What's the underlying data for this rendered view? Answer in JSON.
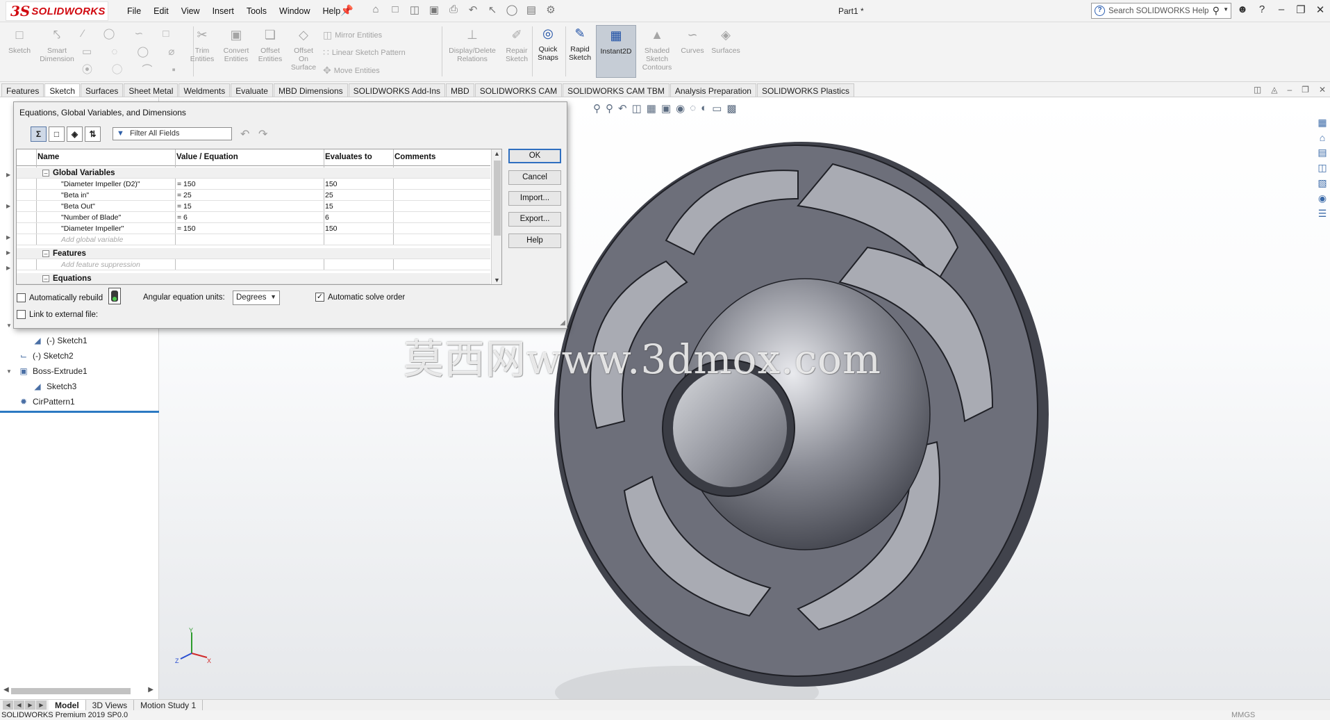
{
  "app": {
    "logo_ds": "3S",
    "logo_text": "SOLIDWORKS",
    "document_title": "Part1 *",
    "search_placeholder": "Search SOLIDWORKS Help"
  },
  "menu": [
    "File",
    "Edit",
    "View",
    "Insert",
    "Tools",
    "Window",
    "Help"
  ],
  "command_manager": {
    "sketch": "Sketch",
    "smart_dimension": [
      "Smart",
      "Dimension"
    ],
    "trim": [
      "Trim",
      "Entities"
    ],
    "convert": [
      "Convert",
      "Entities"
    ],
    "offset": [
      "Offset",
      "Entities"
    ],
    "offset_surface": [
      "Offset",
      "On",
      "Surface"
    ],
    "mirror": "Mirror Entities",
    "linear_pattern": "Linear Sketch Pattern",
    "move": "Move Entities",
    "display_delete": [
      "Display/Delete",
      "Relations"
    ],
    "repair": [
      "Repair",
      "Sketch"
    ],
    "quick_snaps": [
      "Quick",
      "Snaps"
    ],
    "rapid_sketch": [
      "Rapid",
      "Sketch"
    ],
    "instant2d": "Instant2D",
    "shaded_sketch": [
      "Shaded",
      "Sketch",
      "Contours"
    ],
    "curves": "Curves",
    "surfaces": "Surfaces"
  },
  "tabs": [
    {
      "label": "Features",
      "active": false
    },
    {
      "label": "Sketch",
      "active": true
    },
    {
      "label": "Surfaces",
      "active": false
    },
    {
      "label": "Sheet Metal",
      "active": false
    },
    {
      "label": "Weldments",
      "active": false
    },
    {
      "label": "Evaluate",
      "active": false
    },
    {
      "label": "MBD Dimensions",
      "active": false
    },
    {
      "label": "SOLIDWORKS Add-Ins",
      "active": false
    },
    {
      "label": "MBD",
      "active": false
    },
    {
      "label": "SOLIDWORKS CAM",
      "active": false
    },
    {
      "label": "SOLIDWORKS CAM TBM",
      "active": false
    },
    {
      "label": "Analysis Preparation",
      "active": false
    },
    {
      "label": "SOLIDWORKS Plastics",
      "active": false
    }
  ],
  "tree": {
    "sketch1": "(-) Sketch1",
    "sketch2": "(-) Sketch2",
    "boss_extrude1": "Boss-Extrude1",
    "sketch3": "Sketch3",
    "cirpattern1": "CirPattern1"
  },
  "dialog": {
    "title": "Equations, Global Variables, and Dimensions",
    "filter_placeholder": "Filter All Fields",
    "columns": [
      "Name",
      "Value / Equation",
      "Evaluates to",
      "Comments"
    ],
    "group_global": "Global Variables",
    "variables": [
      {
        "name": "\"Diameter Impeller (D2)\"",
        "value": "= 150",
        "evaluates": "150"
      },
      {
        "name": "\"Beta in\"",
        "value": "= 25",
        "evaluates": "25"
      },
      {
        "name": "\"Beta Out\"",
        "value": "= 15",
        "evaluates": "15"
      },
      {
        "name": "\"Number of Blade\"",
        "value": "= 6",
        "evaluates": "6"
      },
      {
        "name": "\"Diameter Impeller\"",
        "value": "= 150",
        "evaluates": "150"
      }
    ],
    "add_global": "Add global variable",
    "group_features": "Features",
    "add_feature": "Add feature suppression",
    "group_equations": "Equations",
    "buttons": {
      "ok": "OK",
      "cancel": "Cancel",
      "import": "Import...",
      "export": "Export...",
      "help": "Help"
    },
    "auto_rebuild": "Automatically rebuild",
    "auto_rebuild_checked": false,
    "angular_units_label": "Angular equation units:",
    "angular_units_value": "Degrees",
    "auto_solve": "Automatic solve order",
    "auto_solve_checked": true,
    "link_external": "Link to external file:",
    "link_external_checked": false
  },
  "viewport": {
    "watermark": "莫西网www.3dmox.com",
    "triad": {
      "x": "X",
      "y": "Y",
      "z": "Z"
    }
  },
  "bottom_tabs": [
    {
      "label": "Model",
      "active": true
    },
    {
      "label": "3D Views",
      "active": false
    },
    {
      "label": "Motion Study 1",
      "active": false
    }
  ],
  "status": {
    "text": "SOLIDWORKS Premium 2019 SP0.0",
    "units": "MMGS"
  },
  "colors": {
    "brand": "#d10a11",
    "selection": "#2b79c2",
    "model": "#6d6f7a"
  }
}
